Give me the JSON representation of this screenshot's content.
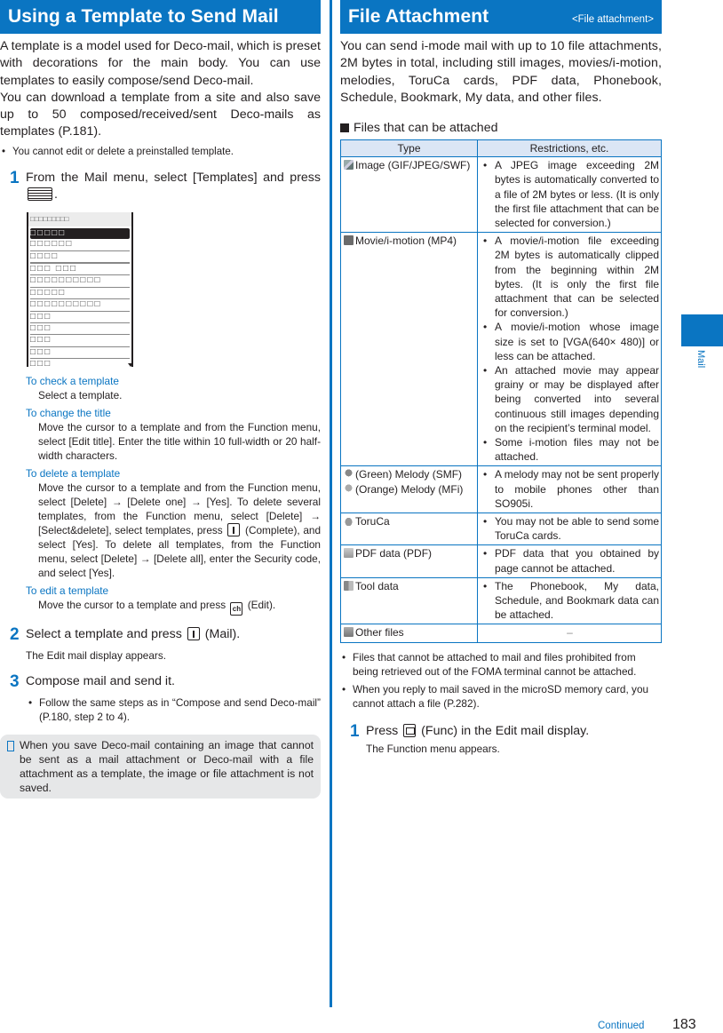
{
  "left": {
    "title": "Using a Template to Send Mail",
    "intro": [
      "A template is a model used for Deco-mail, which is preset with decorations for the main body. You can use templates to easily compose/send Deco-mail.",
      "You can download a template from a site and also save up to 50 composed/received/sent Deco-mails as templates (P.181)."
    ],
    "note": "You cannot edit or delete a preinstalled template.",
    "step1": {
      "num": "1",
      "text_a": "From the Mail menu, select [Templates] and press",
      "text_b": "."
    },
    "screen": {
      "header": "□□□□□□□□□",
      "rows": [
        "□□□□□",
        "□□□□□□",
        "□□□□",
        "□□□ □□□",
        "□□□□□□□□□□",
        "□□□□□",
        "□□□□□□□□□□",
        "□□□",
        "□□□",
        "□□□",
        "□□□",
        "□□□"
      ]
    },
    "subs": [
      {
        "heading": "To check a template",
        "body": "Select a template."
      },
      {
        "heading": "To change the title",
        "body": "Move the cursor to a template and from the Function menu, select [Edit title]. Enter the title within 10 full-width or 20 half-width characters."
      },
      {
        "heading": "To delete a template",
        "body_a": "Move the cursor to a template and from the Function menu, select [Delete] → [Delete one] → [Yes]. To delete several templates, from the Function menu, select [Delete] → [Select&delete], select templates, press",
        "body_b": "(Complete), and select [Yes]. To delete all templates, from the Function menu, select [Delete] → [Delete all], enter the Security code, and select [Yes]."
      },
      {
        "heading": "To edit a template",
        "body_a": "Move the cursor to a template and press",
        "key": "ch",
        "body_b": "(Edit)."
      }
    ],
    "step2": {
      "num": "2",
      "text_a": "Select a template and press",
      "text_b": "(Mail).",
      "desc": "The Edit mail display appears."
    },
    "step3": {
      "num": "3",
      "text": "Compose mail and send it.",
      "bullet": "Follow the same steps as in “Compose and send Deco-mail” (P.180, step 2 to 4)."
    },
    "memo": "When you save Deco-mail containing an image that cannot be sent as a mail attachment or Deco-mail with a file attachment as a template, the image or file attachment is not saved."
  },
  "right": {
    "title": "File Attachment",
    "tag": "<File attachment>",
    "intro": "You can send i-mode mail with up to 10 file attachments, 2M bytes in total, including still images, movies/i-motion, melodies, ToruCa cards, PDF data, Phonebook, Schedule, Bookmark, My data, and other files.",
    "section": "Files that can be attached",
    "table": {
      "headers": [
        "Type",
        "Restrictions, etc."
      ],
      "rows": [
        {
          "icons": [
            "image-icon"
          ],
          "types": [
            "Image (GIF/JPEG/SWF)"
          ],
          "restrictions": [
            "A JPEG image exceeding 2M bytes is automatically converted to a file of 2M bytes or less. (It is only the first file attachment that can be selected for conversion.)"
          ]
        },
        {
          "icons": [
            "movie-icon"
          ],
          "types": [
            "Movie/i-motion (MP4)"
          ],
          "restrictions": [
            "A movie/i-motion file exceeding 2M bytes is automatically clipped from the beginning within 2M bytes. (It is only the first file attachment that can be selected for conversion.)",
            "A movie/i-motion whose image size is set to [VGA(640× 480)] or less can be attached.",
            "An attached movie may appear grainy or may be displayed after being converted into several continuous still images depending on the recipient’s terminal model.",
            "Some i-motion files may not be attached."
          ]
        },
        {
          "icons": [
            "melody-green-icon",
            "melody-orange-icon"
          ],
          "types": [
            "(Green) Melody (SMF)",
            "(Orange) Melody (MFi)"
          ],
          "restrictions": [
            "A melody may not be sent properly to mobile phones other than SO905i."
          ]
        },
        {
          "icons": [
            "toruca-icon"
          ],
          "types": [
            "ToruCa"
          ],
          "restrictions": [
            "You may not be able to send some ToruCa cards."
          ]
        },
        {
          "icons": [
            "pdf-icon"
          ],
          "types": [
            "PDF data (PDF)"
          ],
          "restrictions": [
            "PDF data that you obtained by page cannot be attached."
          ]
        },
        {
          "icons": [
            "tool-data-icon"
          ],
          "types": [
            "Tool data"
          ],
          "restrictions": [
            "The Phonebook, My data, Schedule, and Bookmark data can be attached."
          ]
        },
        {
          "icons": [
            "other-files-icon"
          ],
          "types": [
            "Other files"
          ],
          "restrictions": [],
          "dash": "–"
        }
      ]
    },
    "notes": [
      "Files that cannot be attached to mail and files prohibited from being retrieved out of the FOMA terminal cannot be attached.",
      "When you reply to mail saved in the microSD memory card, you cannot attach a file (P.282)."
    ],
    "step1": {
      "num": "1",
      "text_a": "Press",
      "text_b": "(Func) in the Edit mail display.",
      "desc": "The Function menu appears."
    }
  },
  "side_tab": "Mail",
  "footer": {
    "continued": "Continued",
    "page": "183"
  },
  "colors": {
    "accent": "#0a75c2",
    "table_header": "#dbe6f5",
    "memo_bg": "#e6e7e8"
  }
}
